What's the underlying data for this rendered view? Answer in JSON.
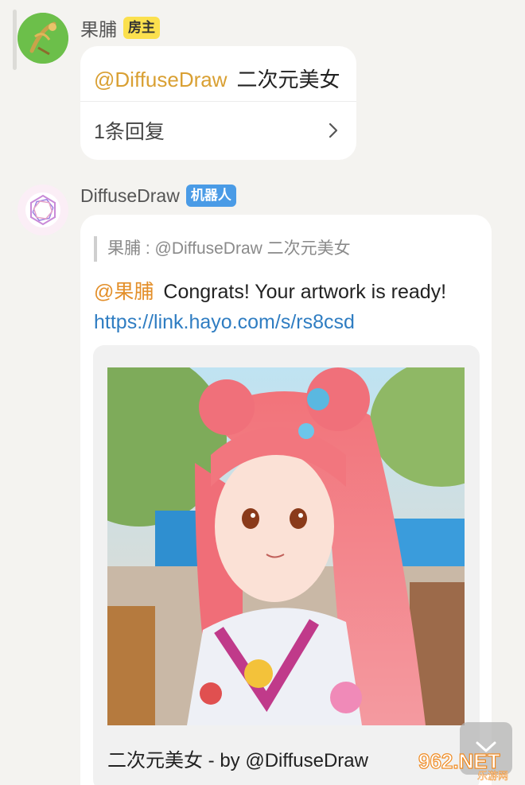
{
  "post": {
    "author": "果脯",
    "badge": "房主",
    "mention": "@DiffuseDraw",
    "text": "二次元美女",
    "reply_count": "1条回复"
  },
  "bot_reply": {
    "author": "DiffuseDraw",
    "badge": "机器人",
    "quote": "果脯 : @DiffuseDraw  二次元美女",
    "mention": "@果脯",
    "message": "Congrats! Your artwork is ready!",
    "link": "https://link.hayo.com/s/rs8csd",
    "image_caption": "二次元美女 - by @DiffuseDraw"
  },
  "watermark": {
    "text": "962.NET",
    "subtext": "乐游网"
  },
  "colors": {
    "owner_badge": "#fbe04e",
    "bot_badge": "#4a9be6",
    "mention": "#d9a033",
    "link": "#2f7dc2"
  }
}
